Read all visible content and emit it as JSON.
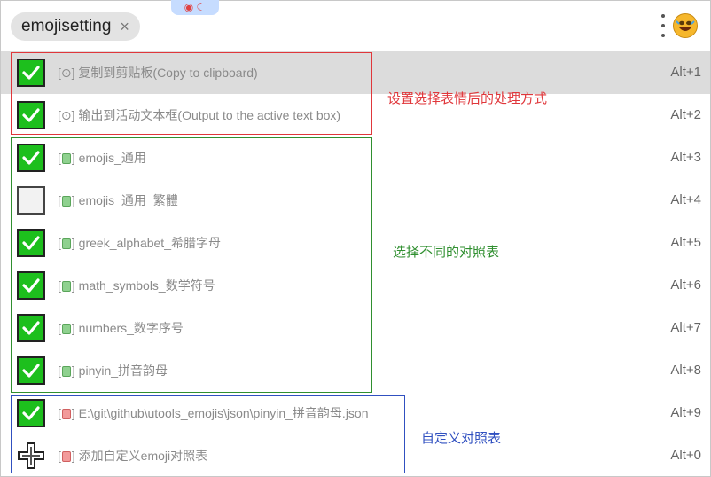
{
  "header": {
    "tag_text": "emojisetting",
    "close_symbol": "×",
    "top_chip_text": "◉ ☾"
  },
  "rows": [
    {
      "checked": true,
      "prefix": "[⊙]",
      "icon": "gear-icon",
      "text": " 复制到剪贴板(Copy to clipboard)",
      "shortcut": "Alt+1",
      "selected": true
    },
    {
      "checked": true,
      "prefix": "[⊙]",
      "icon": "gear-icon",
      "text": " 输出到活动文本框(Output to the active text box)",
      "shortcut": "Alt+2"
    },
    {
      "checked": true,
      "prefix": "[",
      "book": "g",
      "suffix": "]",
      "text": " emojis_通用",
      "shortcut": "Alt+3"
    },
    {
      "checked": false,
      "prefix": "[",
      "book": "g",
      "suffix": "]",
      "text": " emojis_通用_繁體",
      "shortcut": "Alt+4"
    },
    {
      "checked": true,
      "prefix": "[",
      "book": "g",
      "suffix": "]",
      "text": " greek_alphabet_希腊字母",
      "shortcut": "Alt+5"
    },
    {
      "checked": true,
      "prefix": "[",
      "book": "g",
      "suffix": "]",
      "text": " math_symbols_数学符号",
      "shortcut": "Alt+6"
    },
    {
      "checked": true,
      "prefix": "[",
      "book": "g",
      "suffix": "]",
      "text": " numbers_数字序号",
      "shortcut": "Alt+7"
    },
    {
      "checked": true,
      "prefix": "[",
      "book": "g",
      "suffix": "]",
      "text": " pinyin_拼音韵母",
      "shortcut": "Alt+8"
    },
    {
      "checked": true,
      "prefix": "[",
      "book": "r",
      "suffix": "]",
      "text": " E:\\git\\github\\utools_emojis\\json\\pinyin_拼音韵母.json",
      "shortcut": "Alt+9"
    },
    {
      "checked": null,
      "prefix": "[",
      "book": "r",
      "suffix": "]",
      "text": " 添加自定义emoji对照表",
      "shortcut": "Alt+0"
    }
  ],
  "annotations": {
    "red": "设置选择表情后的处理方式",
    "green": "选择不同的对照表",
    "blue": "自定义对照表"
  },
  "colors": {
    "red": "#e0373b",
    "green": "#2f8f2f",
    "blue": "#3050c0"
  }
}
